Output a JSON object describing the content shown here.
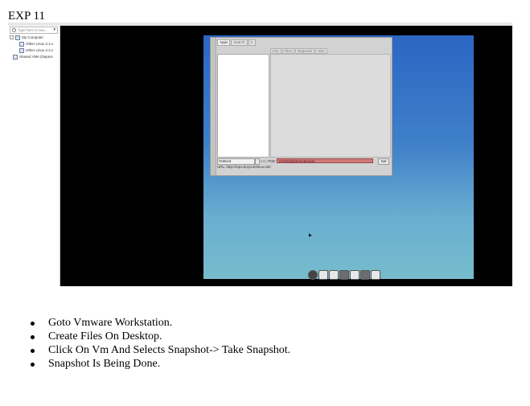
{
  "heading": "EXP 11",
  "vmware_library": {
    "search_placeholder": "Type here to sea...",
    "tree": [
      {
        "label": "My Computer"
      },
      {
        "label": "Other Linux 2.2.x"
      },
      {
        "label": "Other Linux 2.2.x"
      },
      {
        "label": "Shared VMs (Deprec"
      }
    ]
  },
  "guest_app": {
    "tabs": [
      "Apps",
      "Search",
      "X"
    ],
    "columns": [
      "Info",
      "Files",
      "Depends",
      "Size"
    ],
    "select_value": "OnBoot",
    "mini_label": "Mnu",
    "field_label": "TCE:",
    "field_value": "/mnt/sda1/tce/optional",
    "set_button": "Set",
    "url_line": "URL: http://repo.tinycorelinux.net/"
  },
  "dock_icons": [
    "power-icon",
    "pencil-icon",
    "apps-icon",
    "gear-icon",
    "network-icon",
    "terminal-icon",
    "screen-icon"
  ],
  "steps": [
    "Goto Vmware Workstation.",
    "Create Files On Desktop.",
    "Click On Vm And Selects Snapshot-> Take Snapshot.",
    "Snapshot Is Being Done."
  ]
}
